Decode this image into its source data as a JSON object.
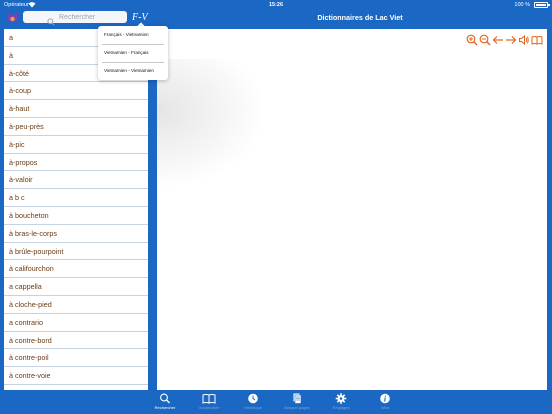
{
  "status_bar": {
    "carrier": "Opérateur",
    "time": "15:26",
    "battery": "100 %",
    "battery_level": 1.0
  },
  "header": {
    "search_placeholder": "Rechercher",
    "direction_label": "F-V",
    "title": "Dictionnaires de Lac Viet"
  },
  "dropdown": {
    "options": [
      "Français - Vietnamien",
      "Vietnamien - Français",
      "Vietnamien - Vietnamien"
    ]
  },
  "word_list": [
    "a",
    "à",
    "à-côté",
    "à-coup",
    "à-haut",
    "à-peu-près",
    "à-pic",
    "à-propos",
    "à-valoir",
    "a b c",
    "à boucheton",
    "à bras-le-corps",
    "à brûle-pourpoint",
    "à califourchon",
    "a cappella",
    "à cloche-pied",
    "a contrario",
    "à contre-bord",
    "à contre-poil",
    "à contre-voie"
  ],
  "toolbar_icons": [
    "zoom-in-icon",
    "zoom-out-icon",
    "arrow-left-icon",
    "arrow-right-icon",
    "speaker-icon",
    "book-icon"
  ],
  "colors": {
    "accent": "#1a67c4",
    "word": "#6b3c16",
    "tool": "#e0661c"
  },
  "tabs": [
    {
      "name": "search",
      "label": "Rechercher",
      "active": true
    },
    {
      "name": "vocabulary",
      "label": "Vocabulaire",
      "active": false
    },
    {
      "name": "history",
      "label": "Historique",
      "active": false
    },
    {
      "name": "bookmarks",
      "label": "Marque-pages",
      "active": false
    },
    {
      "name": "settings",
      "label": "Réglages",
      "active": false
    },
    {
      "name": "info",
      "label": "Infos",
      "active": false
    }
  ]
}
